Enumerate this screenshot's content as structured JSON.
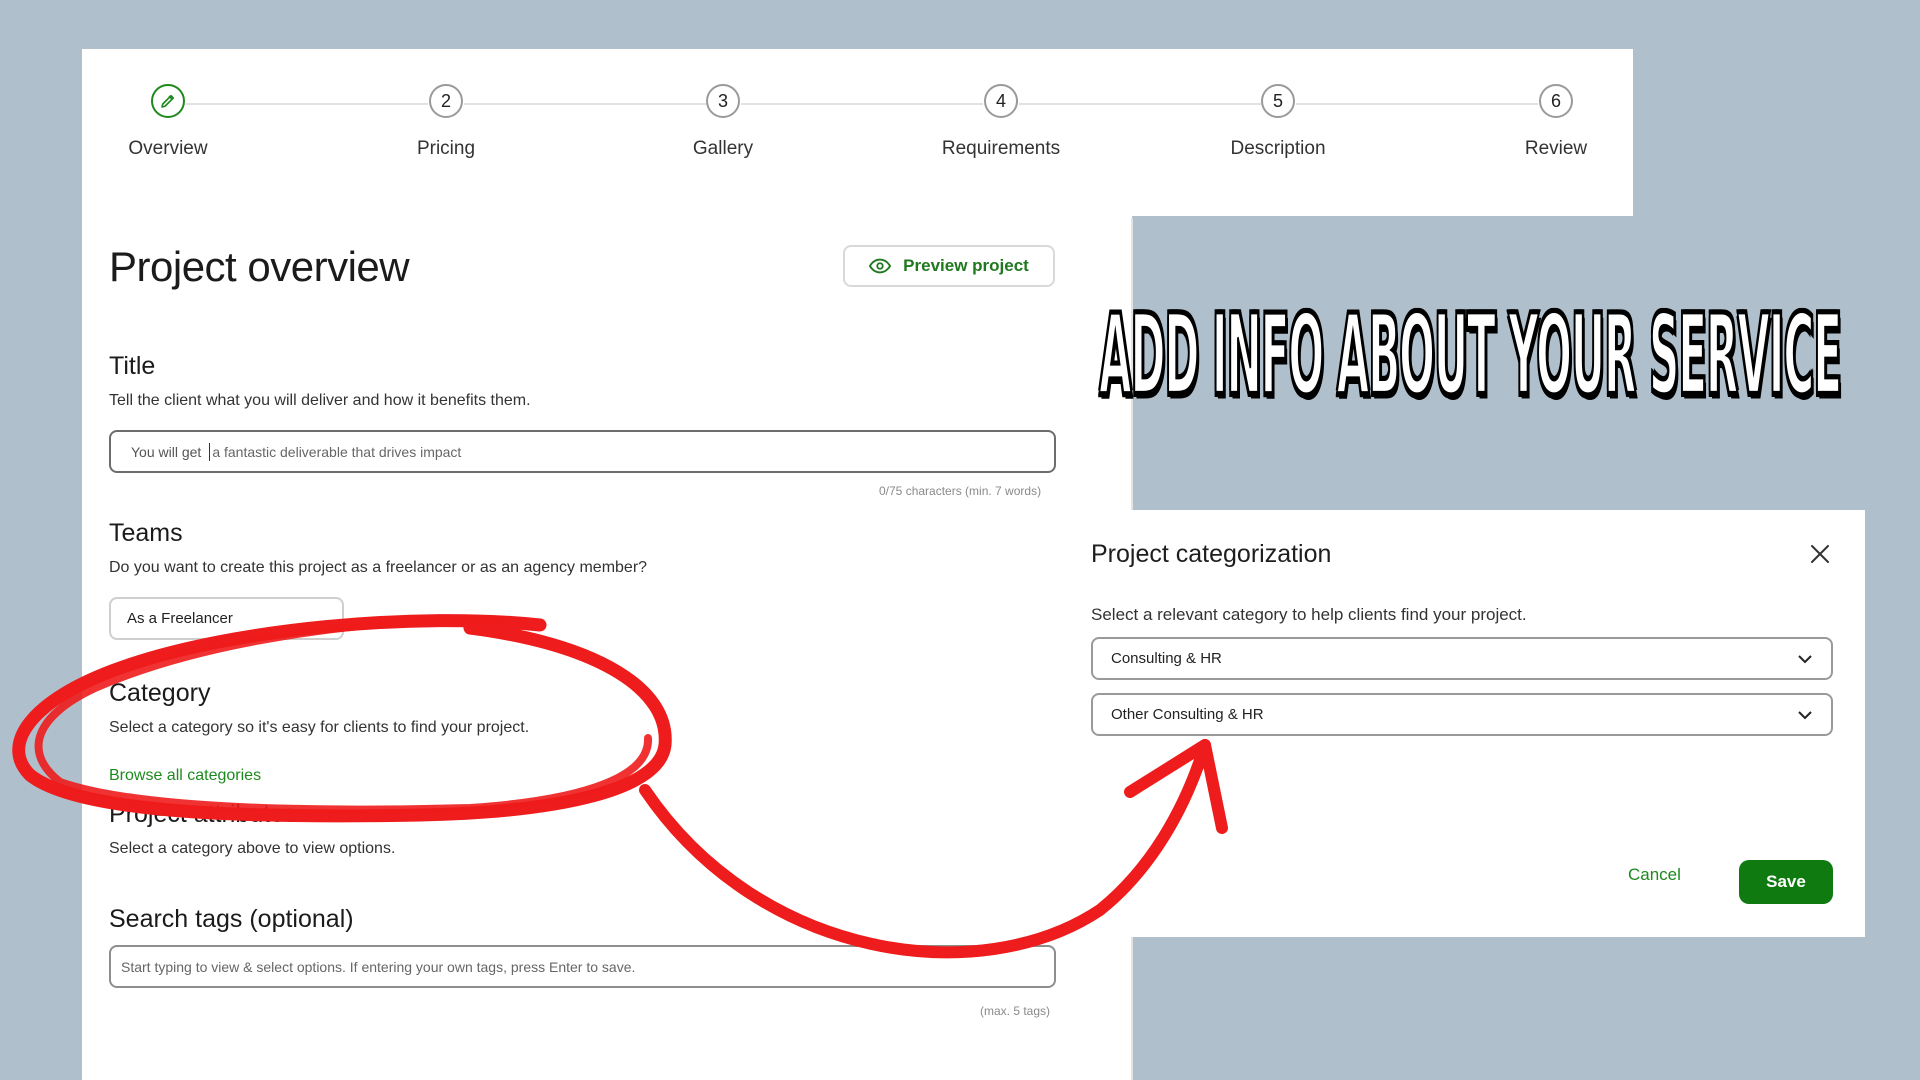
{
  "stepper": {
    "steps": [
      {
        "number": "",
        "label": "Overview",
        "icon": "pencil-icon",
        "state": "active"
      },
      {
        "number": "2",
        "label": "Pricing"
      },
      {
        "number": "3",
        "label": "Gallery"
      },
      {
        "number": "4",
        "label": "Requirements"
      },
      {
        "number": "5",
        "label": "Description"
      },
      {
        "number": "6",
        "label": "Review"
      }
    ]
  },
  "page": {
    "title": "Project overview",
    "preview_button": "Preview project"
  },
  "title_section": {
    "heading": "Title",
    "description": "Tell the client what you will deliver and how it benefits them.",
    "prefix": "You will get",
    "placeholder": "a fantastic deliverable that drives impact",
    "counter": "0/75 characters (min. 7 words)"
  },
  "teams_section": {
    "heading": "Teams",
    "description": "Do you want to create this project as a freelancer or as an agency member?",
    "selected": "As a Freelancer"
  },
  "category_section": {
    "heading": "Category",
    "description": "Select a category so it's easy for clients to find your project.",
    "link": "Browse all categories"
  },
  "attributes_section": {
    "heading": "Project attributes",
    "description": "Select a category above to view options."
  },
  "tags_section": {
    "heading": "Search tags (optional)",
    "placeholder": "Start typing to view & select options. If entering your own tags, press Enter to save.",
    "hint": "(max. 5 tags)"
  },
  "headline": "ADD INFO ABOUT YOUR SERVICE",
  "dialog": {
    "title": "Project categorization",
    "description": "Select a relevant category to help clients find your project.",
    "category_value": "Consulting & HR",
    "subcategory_value": "Other Consulting & HR",
    "cancel": "Cancel",
    "save": "Save"
  },
  "colors": {
    "background": "#afbfcc",
    "accent_green": "#1e8a1e",
    "save_green": "#0f7a0f",
    "annotation_red": "#ee1c1c"
  }
}
